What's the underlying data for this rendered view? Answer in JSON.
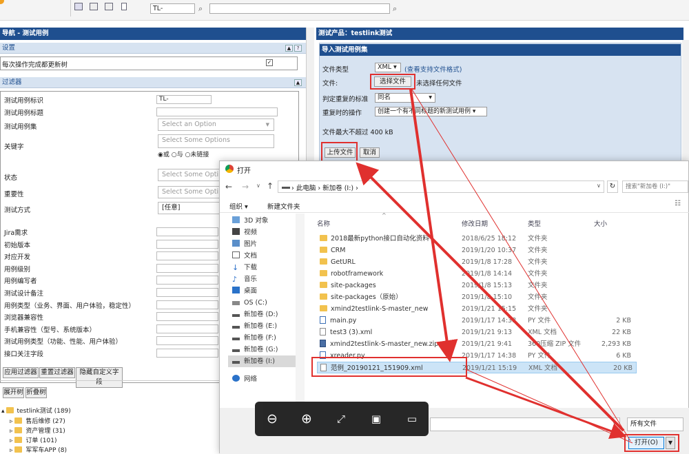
{
  "toolbar": {
    "search_value": "TL-"
  },
  "left": {
    "nav_title": "导航 - 测试用例",
    "settings_title": "设置",
    "settings_item": "每次操作完成都更新树",
    "filter_title": "过滤器",
    "fields": [
      {
        "label": "测试用例标识",
        "value": "TL-"
      },
      {
        "label": "测试用例标题",
        "value": ""
      },
      {
        "label": "测试用例集",
        "value": "Select an Option"
      },
      {
        "label": "关键字",
        "value": "Select Some Options"
      },
      {
        "label": "状态",
        "value": "Select Some Opti"
      },
      {
        "label": "重要性",
        "value": "Select Some Opti"
      },
      {
        "label": "测试方式",
        "value": "[任意]"
      }
    ],
    "keyword_radios": [
      "或",
      "与",
      "未链接"
    ],
    "custom_fields": [
      "Jira需求",
      "初始版本",
      "对应开发",
      "用例级别",
      "用例编写者",
      "测试设计备注",
      "用例类型（业务、界面、用户体验，稳定性）",
      "浏览器兼容性",
      "手机兼容性（型号、系统版本）",
      "测试用例类型（功能、性能、用户体验）",
      "接口关注字段"
    ],
    "filter_buttons": [
      "应用过滤器",
      "重置过滤器",
      "隐藏自定义字段"
    ],
    "tree_buttons": [
      "展开树",
      "折叠树"
    ],
    "tree": [
      "testlink测试 (189)",
      "售后维修 (27)",
      "资产管理 (31)",
      "订单 (101)",
      "军军车APP (8)"
    ]
  },
  "right": {
    "title": "测试产品：testlink测试",
    "section": "导入测试用例集",
    "file_type_label": "文件类型",
    "file_type_value": "XML",
    "supported_link": "(查看支持文件格式)",
    "file_label": "文件:",
    "choose_file": "选择文件",
    "no_file": "未选择任何文件",
    "dup_label": "判定重复的标准",
    "dup_value": "同名",
    "dup_action_label": "重复时的操作",
    "dup_action_value": "创建一个有不同标题的新测试用例",
    "max_size": "文件最大不超过 400 kB",
    "upload": "上传文件",
    "cancel": "取消"
  },
  "dialog": {
    "title": "打开",
    "path": [
      "此电脑",
      "新加卷 (I:)"
    ],
    "search_placeholder": "搜索\"新加卷 (I:)\"",
    "organize": "组织 ▾",
    "new_folder": "新建文件夹",
    "nav_items": [
      "3D 对象",
      "视频",
      "图片",
      "文档",
      "下载",
      "音乐",
      "桌面",
      "OS (C:)",
      "新加卷 (D:)",
      "新加卷 (E:)",
      "新加卷 (F:)",
      "新加卷 (G:)",
      "新加卷 (I:)",
      "网络"
    ],
    "columns": [
      "名称",
      "修改日期",
      "类型",
      "大小"
    ],
    "files": [
      {
        "name": "2018最新python接口自动化资料",
        "date": "2018/6/25 18:12",
        "type": "文件夹",
        "size": "",
        "kind": "folder"
      },
      {
        "name": "CRM",
        "date": "2019/1/20 10:37",
        "type": "文件夹",
        "size": "",
        "kind": "folder"
      },
      {
        "name": "GetURL",
        "date": "2019/1/8 17:28",
        "type": "文件夹",
        "size": "",
        "kind": "folder"
      },
      {
        "name": "robotframework",
        "date": "2019/1/8 14:14",
        "type": "文件夹",
        "size": "",
        "kind": "folder"
      },
      {
        "name": "site-packages",
        "date": "2019/1/8 15:13",
        "type": "文件夹",
        "size": "",
        "kind": "folder"
      },
      {
        "name": "site-packages（原始）",
        "date": "2019/1/8 15:10",
        "type": "文件夹",
        "size": "",
        "kind": "folder"
      },
      {
        "name": "xmind2testlink-S-master_new",
        "date": "2019/1/21 15:15",
        "type": "文件夹",
        "size": "",
        "kind": "folder"
      },
      {
        "name": "main.py",
        "date": "2019/1/17 14:38",
        "type": "PY 文件",
        "size": "2 KB",
        "kind": "py"
      },
      {
        "name": "test3 (3).xml",
        "date": "2019/1/21 9:13",
        "type": "XML 文档",
        "size": "22 KB",
        "kind": "xml"
      },
      {
        "name": "xmind2testlink-S-master_new.zip",
        "date": "2019/1/21 9:41",
        "type": "360压缩 ZIP 文件",
        "size": "2,293 KB",
        "kind": "zip"
      },
      {
        "name": "xreader.py",
        "date": "2019/1/17 14:38",
        "type": "PY 文件",
        "size": "6 KB",
        "kind": "py"
      },
      {
        "name": "范例_20190121_151909.xml",
        "date": "2019/1/21 15:19",
        "type": "XML 文档",
        "size": "20 KB",
        "kind": "xml"
      }
    ],
    "filter_value": "所有文件",
    "open_button": "打开(O)"
  },
  "colors": {
    "nav_blue": "#1f4f8f",
    "highlight_red": "#e0302e",
    "header_light": "#d7e3f1"
  }
}
